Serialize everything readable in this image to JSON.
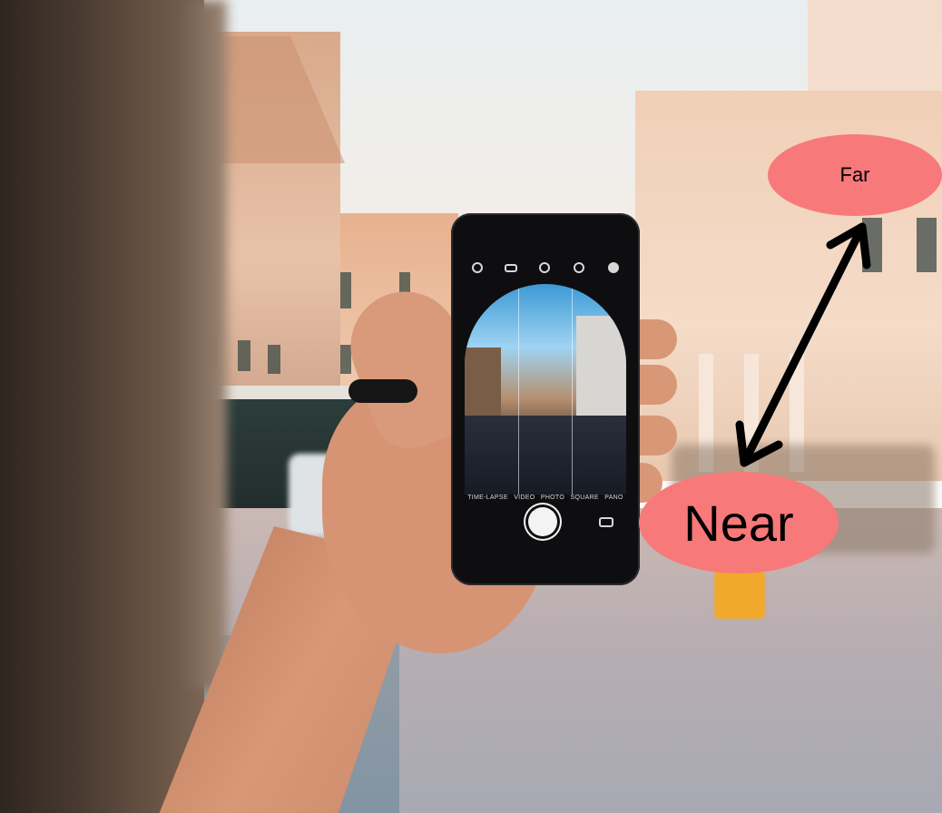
{
  "labels": {
    "far": "Far",
    "near": "Near"
  },
  "camera_modes": [
    "TIME-LAPSE",
    "VIDEO",
    "PHOTO",
    "SQUARE",
    "PANO"
  ],
  "colors": {
    "label_bubble": "#f87979",
    "arrow": "#000000"
  },
  "icons": {
    "phone_top": [
      "flash-icon",
      "hdr-icon",
      "live-photo-icon",
      "timer-icon",
      "filters-icon"
    ],
    "phone_bottom": [
      "shutter-button-icon",
      "camera-flip-icon"
    ]
  }
}
